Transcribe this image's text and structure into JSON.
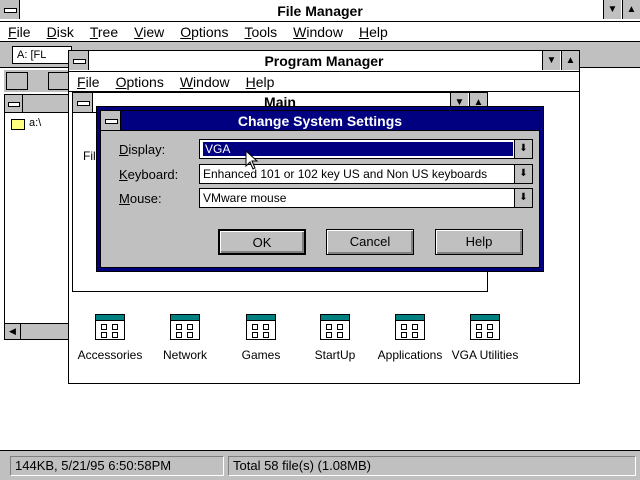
{
  "file_manager": {
    "title": "File Manager",
    "menu": [
      "File",
      "Disk",
      "Tree",
      "View",
      "Options",
      "Tools",
      "Window",
      "Help"
    ],
    "drive_combo": "A: [FL",
    "tree_item": "a:\\",
    "status_left": "144KB, 5/21/95 6:50:58PM",
    "status_right": "Total 58 file(s) (1.08MB)"
  },
  "program_manager": {
    "title": "Program Manager",
    "menu": [
      "File",
      "Options",
      "Window",
      "Help"
    ],
    "main_window": {
      "title": "Main",
      "partial_label": "Fil"
    },
    "groups": [
      {
        "label": "Accessories"
      },
      {
        "label": "Network"
      },
      {
        "label": "Games"
      },
      {
        "label": "StartUp"
      },
      {
        "label": "Applications"
      },
      {
        "label": "VGA Utilities"
      }
    ]
  },
  "dialog": {
    "title": "Change System Settings",
    "display_label": "Display:",
    "display_value": "VGA",
    "keyboard_label": "Keyboard:",
    "keyboard_value": "Enhanced 101 or 102 key US and Non US keyboards",
    "mouse_label": "Mouse:",
    "mouse_value": "VMware mouse",
    "ok_label": "OK",
    "cancel_label": "Cancel",
    "help_label": "Help"
  }
}
